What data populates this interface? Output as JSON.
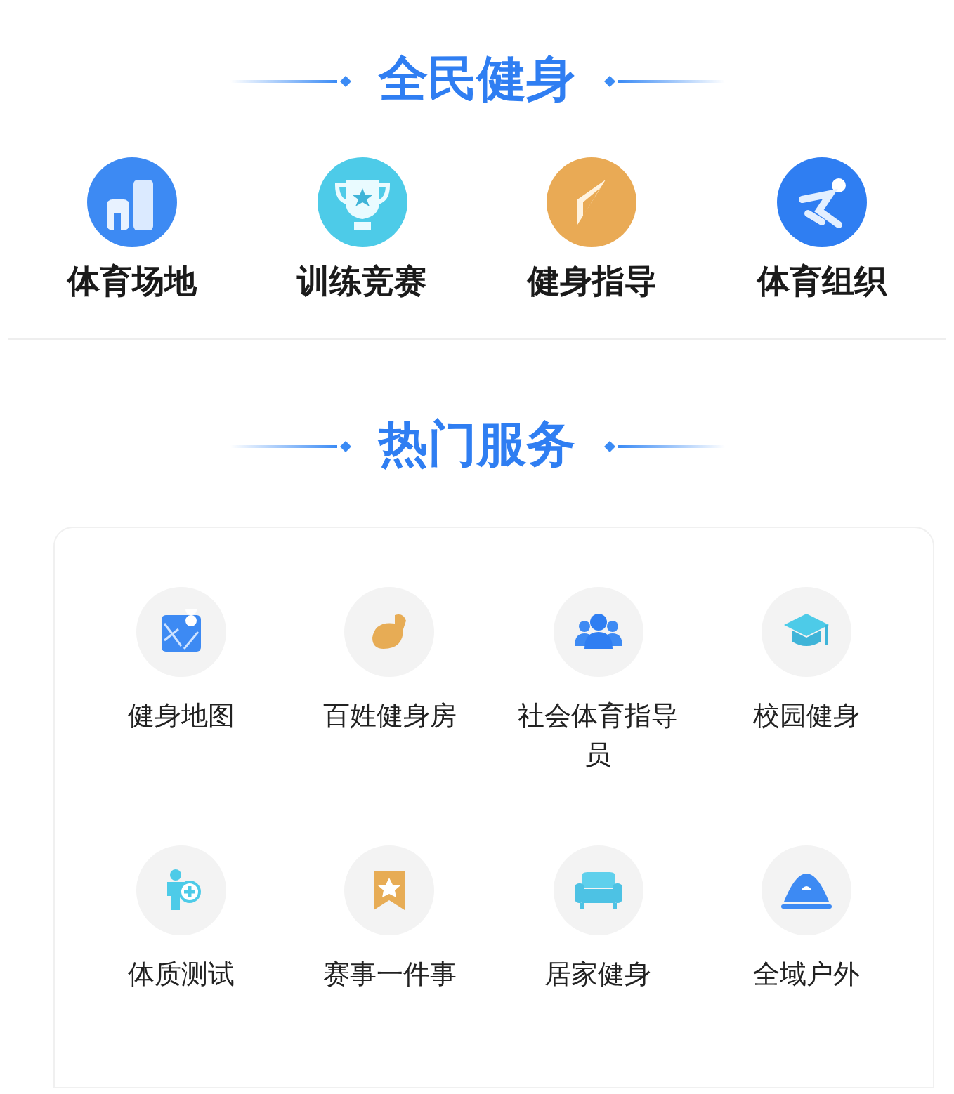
{
  "sections": [
    {
      "title": "全民健身",
      "items": [
        {
          "label": "体育场地"
        },
        {
          "label": "训练竞赛"
        },
        {
          "label": "健身指导"
        },
        {
          "label": "体育组织"
        }
      ]
    },
    {
      "title": "热门服务",
      "items": [
        {
          "label": "健身地图"
        },
        {
          "label": "百姓健身房"
        },
        {
          "label": "社会体育指导员"
        },
        {
          "label": "校园健身"
        },
        {
          "label": "体质测试"
        },
        {
          "label": "赛事一件事"
        },
        {
          "label": "居家健身"
        },
        {
          "label": "全域户外"
        }
      ]
    }
  ]
}
